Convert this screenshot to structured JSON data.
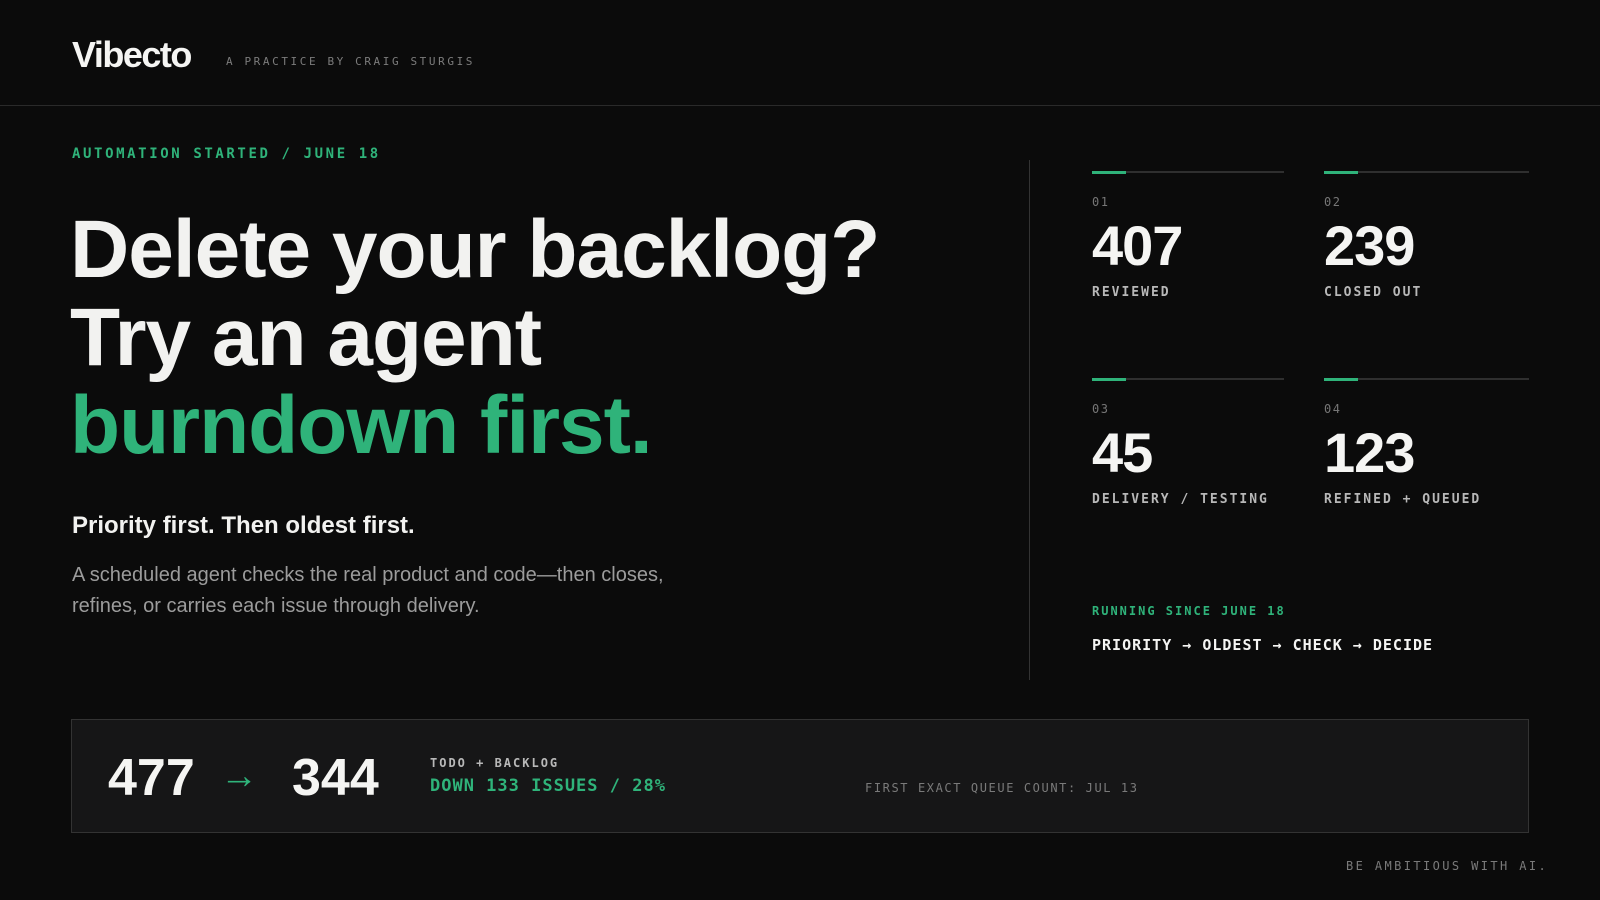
{
  "header": {
    "logo": "Vibecto",
    "tagline": "A PRACTICE BY CRAIG STURGIS"
  },
  "hero": {
    "eyebrow": "AUTOMATION STARTED / JUNE 18",
    "headline_line1": "Delete your backlog?",
    "headline_line2": "Try an agent",
    "headline_line3": "burndown first.",
    "subhead": "Priority first. Then oldest first.",
    "body": "A scheduled agent checks the real product and code—then closes, refines, or carries each issue through delivery."
  },
  "stats": [
    {
      "index": "01",
      "value": "407",
      "label": "REVIEWED"
    },
    {
      "index": "02",
      "value": "239",
      "label": "CLOSED OUT"
    },
    {
      "index": "03",
      "value": "45",
      "label": "DELIVERY / TESTING"
    },
    {
      "index": "04",
      "value": "123",
      "label": "REFINED + QUEUED"
    }
  ],
  "process": {
    "running": "RUNNING SINCE JUNE 18",
    "sequence": "PRIORITY → OLDEST → CHECK → DECIDE"
  },
  "queue": {
    "from": "477",
    "arrow": "→",
    "to": "344",
    "label": "TODO + BACKLOG",
    "delta": "DOWN 133 ISSUES / 28%",
    "note": "FIRST EXACT QUEUE COUNT: JUL 13"
  },
  "footer": {
    "note": "BE AMBITIOUS WITH AI."
  },
  "colors": {
    "background": "#0b0b0b",
    "accent": "#2fb37a",
    "panel": "#161617"
  }
}
